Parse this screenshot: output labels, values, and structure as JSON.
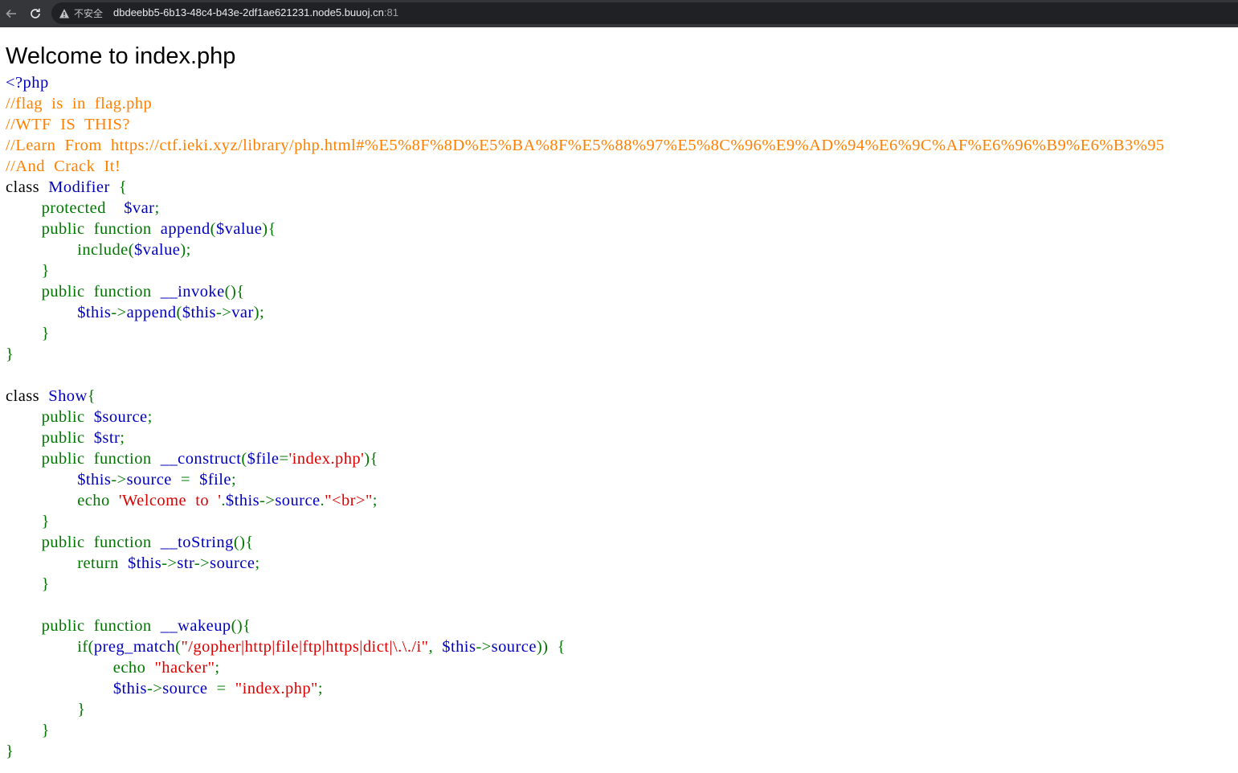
{
  "browser": {
    "security_label": "不安全",
    "url_host": "dbdeebb5-6b13-48c4-b43e-2df1ae621231.node5.buuoj.cn",
    "url_port": ":81",
    "icons": [
      "back-arrow-icon",
      "reload-icon",
      "warning-triangle-icon"
    ],
    "chrome_color": "#35363a"
  },
  "page": {
    "heading": "Welcome to index.php"
  },
  "colors": {
    "html": "#0000bb",
    "keyword": "#007700",
    "comment": "#ff8000",
    "string": "#dd0000"
  },
  "code_lines": [
    [
      [
        "t-html",
        "<?php"
      ]
    ],
    [
      [
        "t-comment",
        "//flag  is  in  flag.php"
      ]
    ],
    [
      [
        "t-comment",
        "//WTF  IS  THIS?"
      ]
    ],
    [
      [
        "t-comment",
        "//Learn  From  https://ctf.ieki.xyz/library/php.html#%E5%8F%8D%E5%BA%8F%E5%88%97%E5%8C%96%E9%AD%94%E6%9C%AF%E6%96%B9%E6%B3%95"
      ]
    ],
    [
      [
        "t-comment",
        "//And  Crack  It!"
      ]
    ],
    [
      [
        "t-black",
        "class  "
      ],
      [
        "t-default",
        "Modifier  "
      ],
      [
        "t-keyword",
        "{"
      ]
    ],
    [
      [
        "t-keyword",
        "        protected    "
      ],
      [
        "t-default",
        "$var"
      ],
      [
        "t-keyword",
        ";"
      ]
    ],
    [
      [
        "t-keyword",
        "        public  function  "
      ],
      [
        "t-default",
        "append"
      ],
      [
        "t-keyword",
        "("
      ],
      [
        "t-default",
        "$value"
      ],
      [
        "t-keyword",
        "){"
      ]
    ],
    [
      [
        "t-keyword",
        "                include("
      ],
      [
        "t-default",
        "$value"
      ],
      [
        "t-keyword",
        ");"
      ]
    ],
    [
      [
        "t-keyword",
        "        }"
      ]
    ],
    [
      [
        "t-keyword",
        "        public  function  "
      ],
      [
        "t-default",
        "__invoke"
      ],
      [
        "t-keyword",
        "(){"
      ]
    ],
    [
      [
        "t-keyword",
        "                "
      ],
      [
        "t-default",
        "$this"
      ],
      [
        "t-keyword",
        "->"
      ],
      [
        "t-default",
        "append"
      ],
      [
        "t-keyword",
        "("
      ],
      [
        "t-default",
        "$this"
      ],
      [
        "t-keyword",
        "->"
      ],
      [
        "t-default",
        "var"
      ],
      [
        "t-keyword",
        ");"
      ]
    ],
    [
      [
        "t-keyword",
        "        }"
      ]
    ],
    [
      [
        "t-keyword",
        "}"
      ]
    ],
    [
      [
        "t-keyword",
        ""
      ]
    ],
    [
      [
        "t-black",
        "class  "
      ],
      [
        "t-default",
        "Show"
      ],
      [
        "t-keyword",
        "{"
      ]
    ],
    [
      [
        "t-keyword",
        "        public  "
      ],
      [
        "t-default",
        "$source"
      ],
      [
        "t-keyword",
        ";"
      ]
    ],
    [
      [
        "t-keyword",
        "        public  "
      ],
      [
        "t-default",
        "$str"
      ],
      [
        "t-keyword",
        ";"
      ]
    ],
    [
      [
        "t-keyword",
        "        public  function  "
      ],
      [
        "t-default",
        "__construct"
      ],
      [
        "t-keyword",
        "("
      ],
      [
        "t-default",
        "$file"
      ],
      [
        "t-keyword",
        "="
      ],
      [
        "t-string",
        "'index.php'"
      ],
      [
        "t-keyword",
        "){"
      ]
    ],
    [
      [
        "t-keyword",
        "                "
      ],
      [
        "t-default",
        "$this"
      ],
      [
        "t-keyword",
        "->"
      ],
      [
        "t-default",
        "source  "
      ],
      [
        "t-keyword",
        "=  "
      ],
      [
        "t-default",
        "$file"
      ],
      [
        "t-keyword",
        ";"
      ]
    ],
    [
      [
        "t-keyword",
        "                echo  "
      ],
      [
        "t-string",
        "'Welcome  to  '"
      ],
      [
        "t-keyword",
        "."
      ],
      [
        "t-default",
        "$this"
      ],
      [
        "t-keyword",
        "->"
      ],
      [
        "t-default",
        "source"
      ],
      [
        "t-keyword",
        "."
      ],
      [
        "t-string",
        "\"<br>\""
      ],
      [
        "t-keyword",
        ";"
      ]
    ],
    [
      [
        "t-keyword",
        "        }"
      ]
    ],
    [
      [
        "t-keyword",
        "        public  function  "
      ],
      [
        "t-default",
        "__toString"
      ],
      [
        "t-keyword",
        "(){"
      ]
    ],
    [
      [
        "t-keyword",
        "                return  "
      ],
      [
        "t-default",
        "$this"
      ],
      [
        "t-keyword",
        "->"
      ],
      [
        "t-default",
        "str"
      ],
      [
        "t-keyword",
        "->"
      ],
      [
        "t-default",
        "source"
      ],
      [
        "t-keyword",
        ";"
      ]
    ],
    [
      [
        "t-keyword",
        "        }"
      ]
    ],
    [
      [
        "t-keyword",
        ""
      ]
    ],
    [
      [
        "t-keyword",
        "        public  function  "
      ],
      [
        "t-default",
        "__wakeup"
      ],
      [
        "t-keyword",
        "(){"
      ]
    ],
    [
      [
        "t-keyword",
        "                if("
      ],
      [
        "t-default",
        "preg_match"
      ],
      [
        "t-keyword",
        "("
      ],
      [
        "t-string",
        "\"/gopher|http|file|ftp|https|dict|\\.\\./i\""
      ],
      [
        "t-keyword",
        ",  "
      ],
      [
        "t-default",
        "$this"
      ],
      [
        "t-keyword",
        "->"
      ],
      [
        "t-default",
        "source"
      ],
      [
        "t-keyword",
        "))  {"
      ]
    ],
    [
      [
        "t-keyword",
        "                        echo  "
      ],
      [
        "t-string",
        "\"hacker\""
      ],
      [
        "t-keyword",
        ";"
      ]
    ],
    [
      [
        "t-keyword",
        "                        "
      ],
      [
        "t-default",
        "$this"
      ],
      [
        "t-keyword",
        "->"
      ],
      [
        "t-default",
        "source  "
      ],
      [
        "t-keyword",
        "=  "
      ],
      [
        "t-string",
        "\"index.php\""
      ],
      [
        "t-keyword",
        ";"
      ]
    ],
    [
      [
        "t-keyword",
        "                }"
      ]
    ],
    [
      [
        "t-keyword",
        "        }"
      ]
    ],
    [
      [
        "t-keyword",
        "}"
      ]
    ]
  ]
}
